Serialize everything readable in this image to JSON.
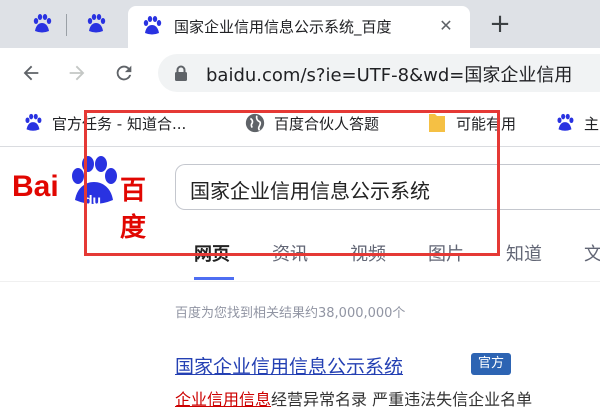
{
  "browser": {
    "active_tab_title": "国家企业信用信息公示系统_百度",
    "close_glyph": "✕",
    "new_tab_glyph": "+",
    "url": "baidu.com/s?ie=UTF-8&wd=国家企业信用",
    "bookmarks": [
      {
        "label": "官方任务 - 知道合...",
        "icon": "baidu-paw-icon"
      },
      {
        "label": "百度合伙人答题",
        "icon": "globe-icon"
      },
      {
        "label": "可能有用",
        "icon": "folder-icon"
      },
      {
        "label": "主",
        "icon": "baidu-paw-icon"
      }
    ]
  },
  "page": {
    "logo": {
      "left": "Bai",
      "paw_text": "du",
      "right": "百度"
    },
    "search_query": "国家企业信用信息公示系统",
    "tabs": [
      "网页",
      "资讯",
      "视频",
      "图片",
      "知道",
      "文"
    ],
    "result_count": "百度为您找到相关结果约38,000,000个",
    "first_result": {
      "title": "国家企业信用信息公示系统",
      "badge": "官方",
      "snippet_highlight": "企业信用信息",
      "snippet_rest": "经营异常名录 严重违法失信企业名单"
    }
  },
  "colors": {
    "baidu_red": "#e10601",
    "baidu_blue": "#4e6ef2",
    "annotation_red": "#e53935"
  }
}
